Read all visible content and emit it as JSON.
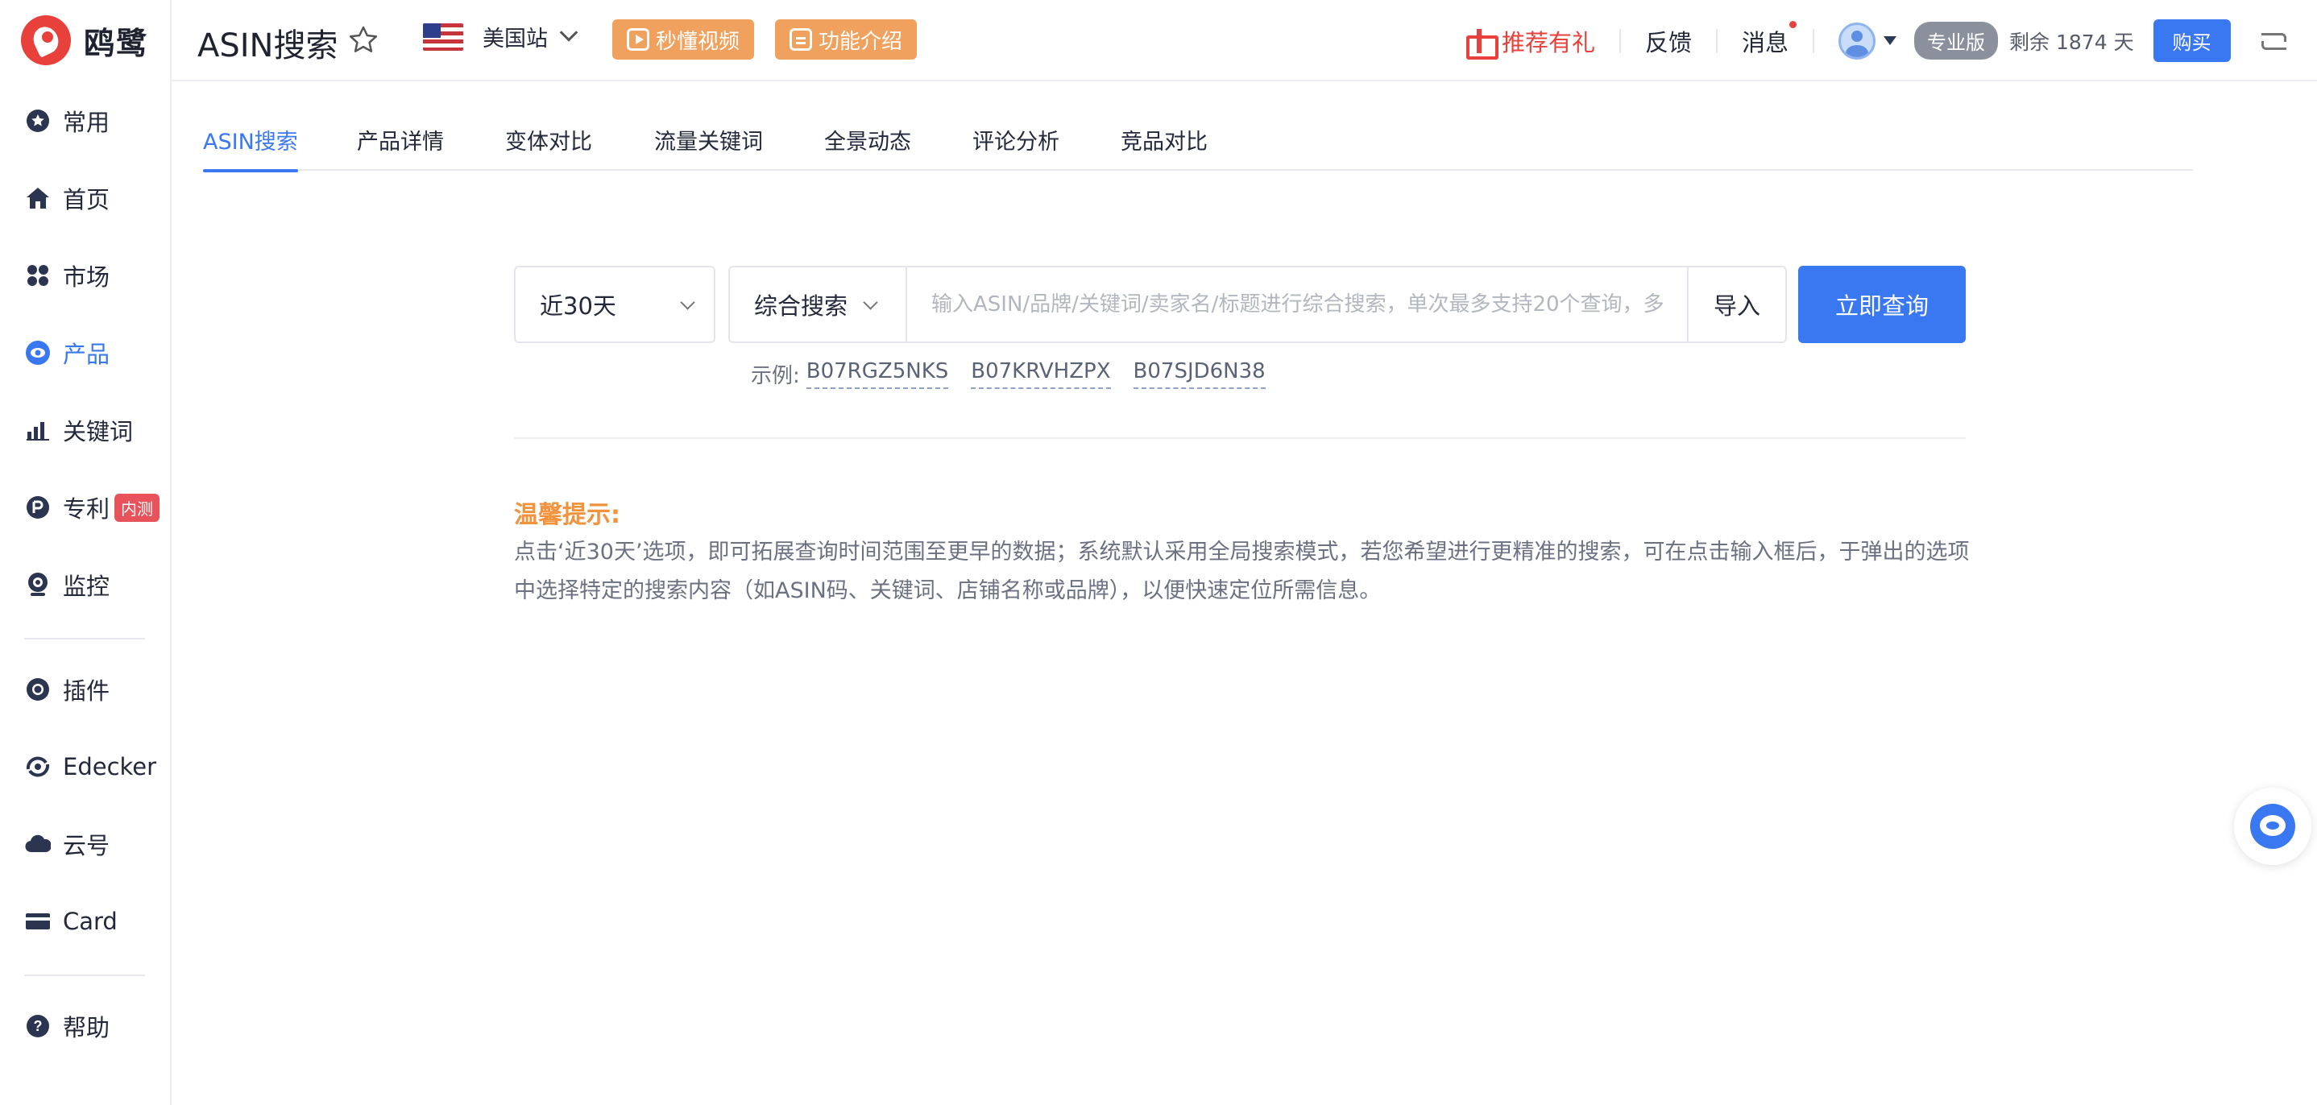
{
  "app": {
    "logo_text": "鸥鹭",
    "brand_color": "#e8403a",
    "accent_color": "#3a78f2"
  },
  "sidebar": {
    "items": [
      {
        "label": "常用",
        "icon": "star-badge-icon"
      },
      {
        "label": "首页",
        "icon": "home-icon"
      },
      {
        "label": "市场",
        "icon": "grid-icon"
      },
      {
        "label": "产品",
        "icon": "eye-icon",
        "active": true
      },
      {
        "label": "关键词",
        "icon": "bar-chart-icon"
      },
      {
        "label": "专利",
        "icon": "patent-icon",
        "badge": "内测"
      },
      {
        "label": "监控",
        "icon": "webcam-icon"
      },
      {
        "label": "插件",
        "icon": "chrome-icon"
      },
      {
        "label": "Edecker",
        "icon": "edecker-icon"
      },
      {
        "label": "云号",
        "icon": "cloud-icon"
      },
      {
        "label": "Card",
        "icon": "card-icon"
      },
      {
        "label": "帮助",
        "icon": "help-icon"
      }
    ]
  },
  "header": {
    "title": "ASIN搜索",
    "site": "美国站",
    "video_btn": "秒懂视频",
    "intro_btn": "功能介绍",
    "referral": "推荐有礼",
    "feedback": "反馈",
    "messages": "消息",
    "plan": "专业版",
    "remaining": "剩余 1874 天",
    "buy": "购买"
  },
  "tabs": [
    "ASIN搜索",
    "产品详情",
    "变体对比",
    "流量关键词",
    "全景动态",
    "评论分析",
    "竞品对比"
  ],
  "search": {
    "range": "近30天",
    "mode": "综合搜索",
    "placeholder": "输入ASIN/品牌/关键词/卖家名/标题进行综合搜索，单次最多支持20个查询，多",
    "value": "",
    "import": "导入",
    "submit": "立即查询",
    "examples_label": "示例:",
    "examples": [
      "B07RGZ5NKS",
      "B07KRVHZPX",
      "B07SJD6N38"
    ]
  },
  "tip": {
    "title": "温馨提示:",
    "text": "点击‘近30天’选项，即可拓展查询时间范围至更早的数据；系统默认采用全局搜索模式，若您希望进行更精准的搜索，可在点击输入框后，于弹出的选项中选择特定的搜索内容（如ASIN码、关键词、店铺名称或品牌），以便快速定位所需信息。"
  }
}
